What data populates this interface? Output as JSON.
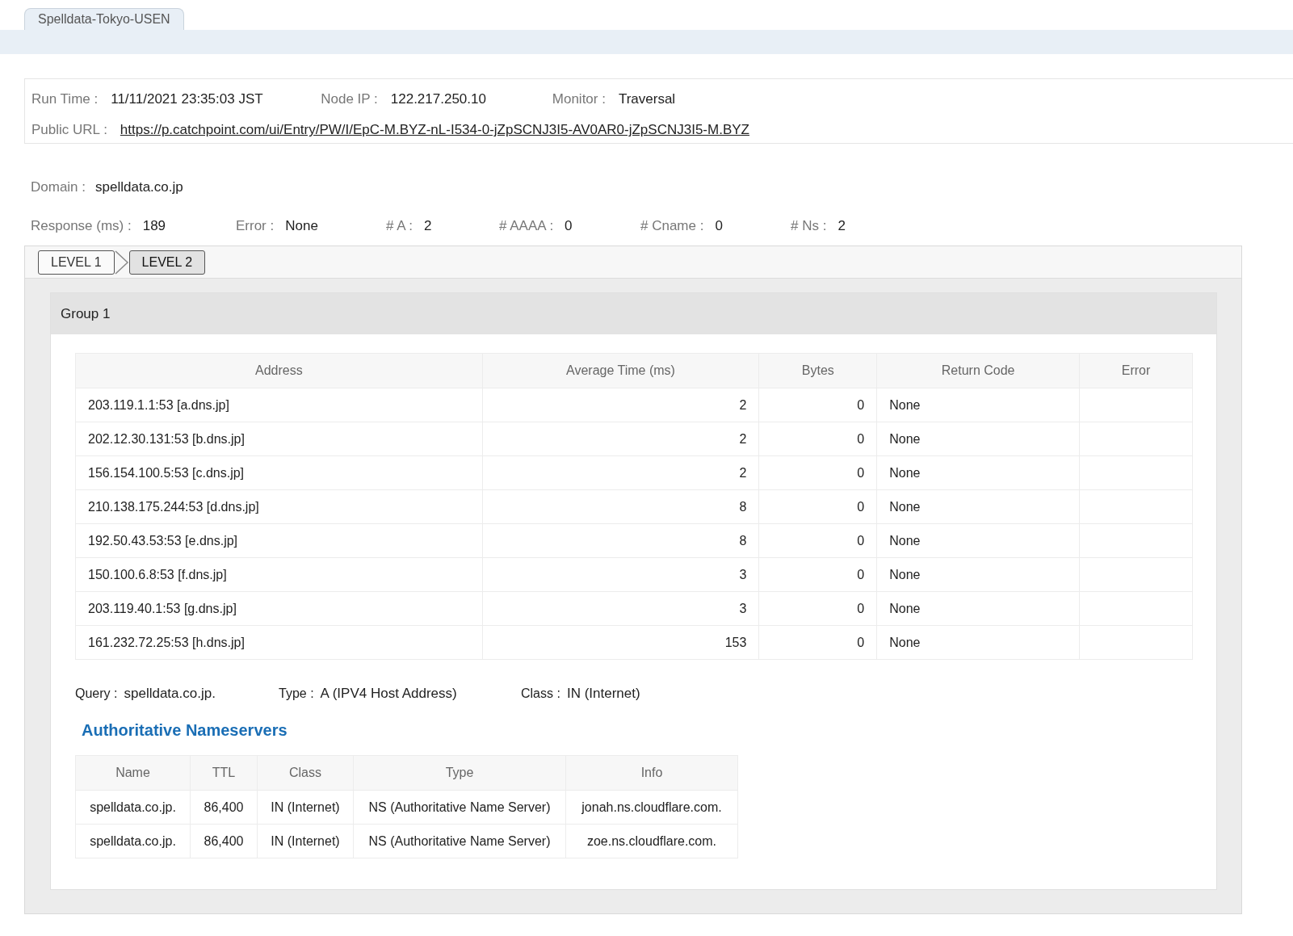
{
  "tabs": [
    {
      "label": "Spelldata-Tokyo-USEN",
      "selected": true
    }
  ],
  "run_info": {
    "run_time_label": "Run Time :",
    "run_time": "11/11/2021 23:35:03 JST",
    "node_ip_label": "Node IP :",
    "node_ip": "122.217.250.10",
    "monitor_label": "Monitor :",
    "monitor": "Traversal",
    "public_url_label": "Public URL :",
    "public_url": "https://p.catchpoint.com/ui/Entry/PW/I/EpC-M.BYZ-nL-I534-0-jZpSCNJ3I5-AV0AR0-jZpSCNJ3I5-M.BYZ"
  },
  "domain": {
    "label": "Domain :",
    "value": "spelldata.co.jp"
  },
  "stats": [
    {
      "label": "Response (ms) :",
      "value": "189"
    },
    {
      "label": "Error :",
      "value": "None"
    },
    {
      "label": "# A :",
      "value": "2"
    },
    {
      "label": "# AAAA :",
      "value": "0"
    },
    {
      "label": "# Cname :",
      "value": "0"
    },
    {
      "label": "# Ns :",
      "value": "2"
    }
  ],
  "levels": [
    {
      "label": "LEVEL 1",
      "selected": false
    },
    {
      "label": "LEVEL 2",
      "selected": true
    }
  ],
  "group": {
    "title": "Group 1",
    "table": {
      "columns": [
        "Address",
        "Average Time (ms)",
        "Bytes",
        "Return Code",
        "Error"
      ],
      "rows": [
        [
          "203.119.1.1:53 [a.dns.jp]",
          "2",
          "0",
          "None"
        ],
        [
          "202.12.30.131:53 [b.dns.jp]",
          "2",
          "0",
          "None"
        ],
        [
          "156.154.100.5:53 [c.dns.jp]",
          "2",
          "0",
          "None"
        ],
        [
          "210.138.175.244:53 [d.dns.jp]",
          "8",
          "0",
          "None"
        ],
        [
          "192.50.43.53:53 [e.dns.jp]",
          "8",
          "0",
          "None"
        ],
        [
          "150.100.6.8:53 [f.dns.jp]",
          "3",
          "0",
          "None"
        ],
        [
          "203.119.40.1:53 [g.dns.jp]",
          "3",
          "0",
          "None"
        ],
        [
          "161.232.72.25:53 [h.dns.jp]",
          "153",
          "0",
          "None"
        ]
      ]
    },
    "query": [
      {
        "label": "Query :",
        "value": "spelldata.co.jp."
      },
      {
        "label": "Type :",
        "value": "A (IPV4 Host Address)"
      },
      {
        "label": "Class :",
        "value": "IN (Internet)"
      }
    ],
    "ns_heading": "Authoritative Nameservers",
    "ns_table": {
      "columns": [
        "Name",
        "TTL",
        "Class",
        "Type",
        "Info"
      ],
      "rows": [
        [
          "spelldata.co.jp.",
          "86,400",
          "IN (Internet)",
          "NS (Authoritative Name Server)",
          "jonah.ns.cloudflare.com."
        ],
        [
          "spelldata.co.jp.",
          "86,400",
          "IN (Internet)",
          "NS (Authoritative Name Server)",
          "zoe.ns.cloudflare.com."
        ]
      ]
    }
  }
}
